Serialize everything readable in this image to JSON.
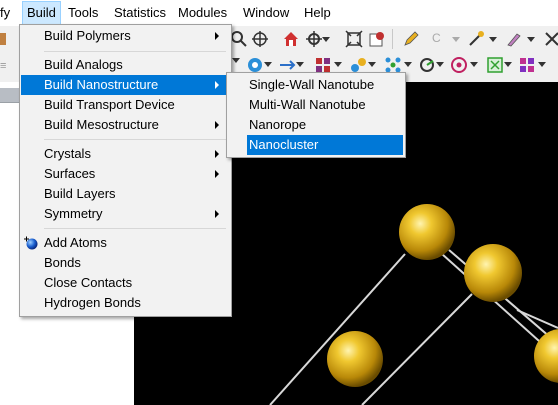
{
  "menubar": {
    "items": [
      "fy",
      "Build",
      "Tools",
      "Statistics",
      "Modules",
      "Window",
      "Help"
    ]
  },
  "build_menu": {
    "items": [
      {
        "label": "Build Polymers",
        "submenu": true
      },
      {
        "label": "Build Analogs",
        "submenu": false
      },
      {
        "label": "Build Nanostructure",
        "submenu": true,
        "highlighted": true
      },
      {
        "label": "Build Transport Device",
        "submenu": false
      },
      {
        "label": "Build Mesostructure",
        "submenu": true
      },
      {
        "label": "Crystals",
        "submenu": true
      },
      {
        "label": "Surfaces",
        "submenu": true
      },
      {
        "label": "Build Layers",
        "submenu": false
      },
      {
        "label": "Symmetry",
        "submenu": true
      },
      {
        "label": "Add Atoms",
        "submenu": false,
        "icon": "add-atom-icon"
      },
      {
        "label": "Bonds",
        "submenu": false
      },
      {
        "label": "Close Contacts",
        "submenu": false
      },
      {
        "label": "Hydrogen Bonds",
        "submenu": false
      }
    ]
  },
  "nanostructure_submenu": {
    "items": [
      {
        "label": "Single-Wall Nanotube"
      },
      {
        "label": "Multi-Wall Nanotube"
      },
      {
        "label": "Nanorope"
      },
      {
        "label": "Nanocluster",
        "highlighted": true
      }
    ]
  },
  "toolbar_row1_icons": [
    "build-icon",
    "search-icon",
    "move-icon",
    "home-icon",
    "target-icon",
    "fit-icon",
    "settings-icon",
    "pencil-icon",
    "carbon-icon",
    "bond-icon",
    "brush-icon",
    "close-icon"
  ],
  "toolbar_row2_icons": [
    "display-icon",
    "rotate-icon",
    "arrow-icon",
    "molecule-icon",
    "atoms-icon",
    "tool-icon",
    "radar-icon",
    "grid-icon",
    "palette-icon"
  ],
  "viewport": {
    "background": "#000000",
    "atom_color": "#e0b020",
    "bond_color": "#d8d8d8"
  },
  "colors": {
    "highlight": "#0078d7",
    "menu_bg": "#f2f2f2"
  }
}
